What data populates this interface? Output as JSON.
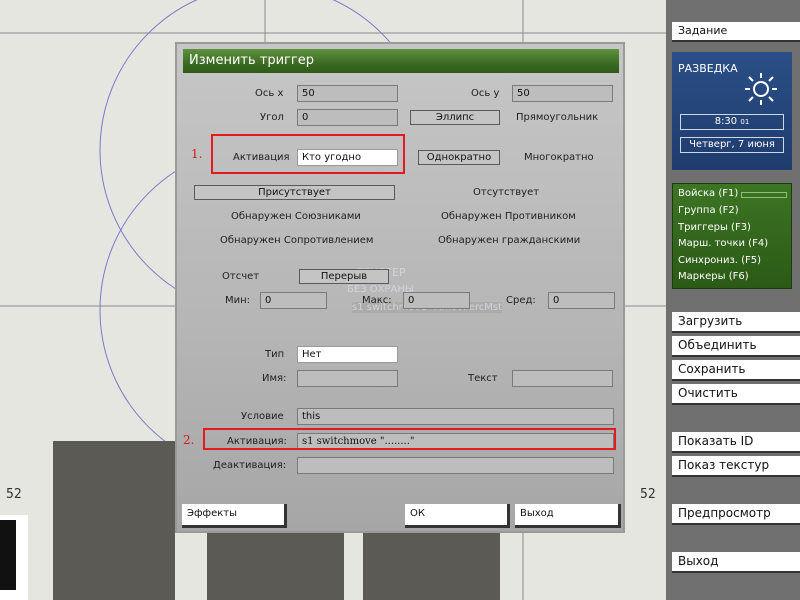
{
  "map": {
    "label_left": "52",
    "label_right": "52"
  },
  "dialog": {
    "title": "Изменить триггер",
    "axis_x": {
      "label": "Ось x",
      "value": "50"
    },
    "axis_y": {
      "label": "Ось y",
      "value": "50"
    },
    "angle": {
      "label": "Угол",
      "value": "0"
    },
    "shape_ellipse": "Эллипс",
    "shape_rectangle": "Прямоугольник",
    "activation": {
      "label": "Активация",
      "value": "Кто угодно"
    },
    "once": "Однократно",
    "repeatedly": "Многократно",
    "present": "Присутствует",
    "absent": "Отсутствует",
    "detected_allies": "Обнаружен Союзниками",
    "detected_enemy": "Обнаружен Противником",
    "detected_resistance": "Обнаружен Сопротивлением",
    "detected_civilians": "Обнаружен гражданскими",
    "countdown": "Отсчет",
    "timeout": "Перерыв",
    "min": {
      "label": "Мин:",
      "value": "0"
    },
    "max": {
      "label": "Макс:",
      "value": "0"
    },
    "mid": {
      "label": "Сред:",
      "value": "0"
    },
    "type": {
      "label": "Тип",
      "value": "Нет"
    },
    "name": {
      "label": "Имя:",
      "value": ""
    },
    "text": {
      "label": "Текст",
      "value": ""
    },
    "condition": {
      "label": "Условие",
      "value": "this"
    },
    "on_activation": {
      "label": "Активация:",
      "value": "s1 switchmove \"........\""
    },
    "on_deactivation": {
      "label": "Деактивация:",
      "value": ""
    },
    "effects_button": "Эффекты",
    "ok_button": "ОК",
    "exit_button": "Выход",
    "ghost_line1": "ТРИГГЕР",
    "ghost_line2": "БЕЗ ОХРАНЫ",
    "ghost_line3": "s1 switchmove \"AmovPercMst"
  },
  "annotations": {
    "mark1": "1.",
    "mark2": "2.",
    "color": "#e21c1c"
  },
  "panel": {
    "task_button": "Задание",
    "recon": {
      "title": "РАЗВЕДКА",
      "time": "8:30",
      "seconds": "01",
      "date": "Четверг, 7 июня",
      "icon": "sun-icon"
    },
    "groups": [
      "Войска (F1)",
      "Группа (F2)",
      "Триггеры (F3)",
      "Марш. точки (F4)",
      "Синхрониз. (F5)",
      "Маркеры (F6)"
    ],
    "load": "Загрузить",
    "merge": "Объединить",
    "save": "Сохранить",
    "clear": "Очистить",
    "show_id": "Показать ID",
    "show_textures": "Показ текстур",
    "preview": "Предпросмотр",
    "exit": "Выход"
  }
}
